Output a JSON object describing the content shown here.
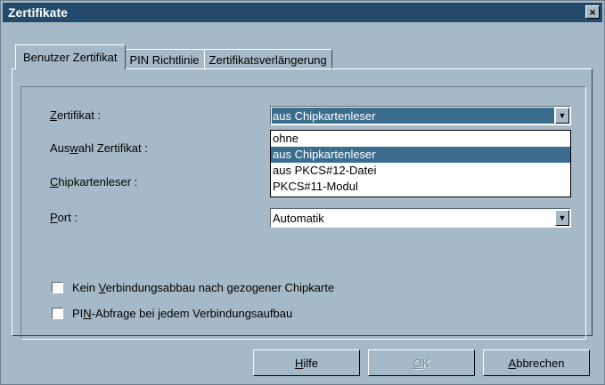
{
  "window": {
    "title": "Zertifikate",
    "close_glyph": "×"
  },
  "tabs": [
    {
      "label": "Benutzer Zertifikat",
      "active": true
    },
    {
      "label": "PIN Richtlinie",
      "active": false
    },
    {
      "label": "Zertifikatsverlängerung",
      "active": false
    }
  ],
  "fields": {
    "zertifikat": {
      "label_u": "Z",
      "label_rest": "ertifikat :",
      "value": "aus Chipkartenleser"
    },
    "auswahl": {
      "label_a": "Aus",
      "label_u": "w",
      "label_rest": "ahl Zertifikat :"
    },
    "chipkartenleser": {
      "label_u": "C",
      "label_rest": "hipkartenleser :"
    },
    "port": {
      "label_u": "P",
      "label_rest": "ort :",
      "value": "Automatik"
    }
  },
  "dropdown": {
    "options": [
      "ohne",
      "aus Chipkartenleser",
      "aus PKCS#12-Datei",
      "PKCS#11-Modul"
    ],
    "selected_index": 1
  },
  "checkboxes": [
    {
      "pre": "Kein ",
      "u": "V",
      "rest": "erbindungsabbau nach gezogener Chipkarte",
      "checked": false
    },
    {
      "pre": "PI",
      "u": "N",
      "rest": "-Abfrage bei jedem Verbindungsaufbau",
      "checked": false
    }
  ],
  "buttons": {
    "hilfe": {
      "u": "H",
      "rest": "ilfe"
    },
    "ok": {
      "u": "O",
      "rest": "K",
      "enabled": false
    },
    "abbrechen": {
      "u": "A",
      "rest": "bbrechen"
    }
  },
  "colors": {
    "dialog_bg": "#a5bac6",
    "titlebar": "#244a6b",
    "selection": "#3b6d8f"
  },
  "icons": {
    "combo_arrow": "▼"
  }
}
